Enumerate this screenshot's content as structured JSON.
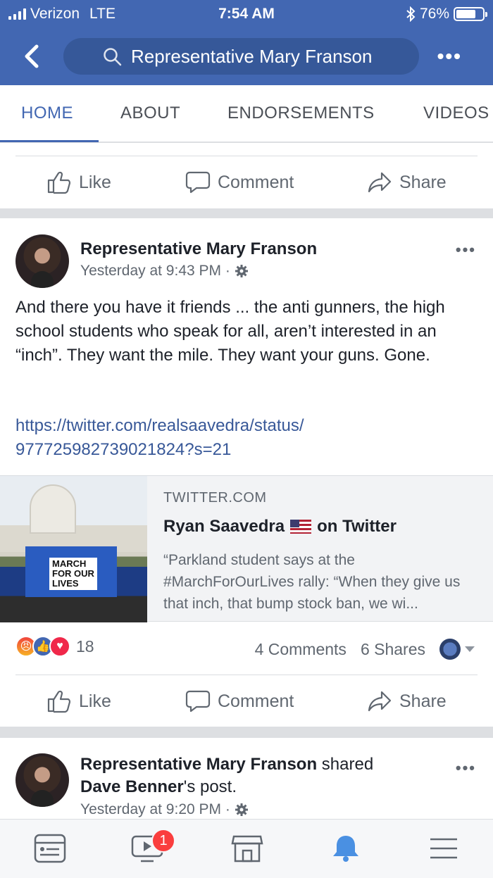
{
  "status": {
    "carrier": "Verizon",
    "network": "LTE",
    "time": "7:54 AM",
    "battery": "76%",
    "battery_level": 0.76
  },
  "header": {
    "search_text": "Representative Mary Franson"
  },
  "tabs": [
    "HOME",
    "ABOUT",
    "ENDORSEMENTS",
    "VIDEOS"
  ],
  "actions": {
    "like": "Like",
    "comment": "Comment",
    "share": "Share"
  },
  "post1": {
    "author": "Representative Mary Franson",
    "time": "Yesterday at 9:43 PM ·",
    "text": "And there you have it friends ... the anti gunners, the high school students who speak for all, aren’t interested in an “inch”. They want the mile. They want your guns. Gone.",
    "link_line1": "https://twitter.com/realsaavedra/status/",
    "link_line2": "977725982739021824?s=21",
    "preview": {
      "domain": "TWITTER.COM",
      "title_a": "Ryan Saavedra",
      "title_b": "on Twitter",
      "description": "“Parkland student says at the #MarchForOurLives rally: “When they give us that inch, that bump stock ban, we wi...",
      "sign_text_line1": "MARCH",
      "sign_text_line2": "FOR OUR",
      "sign_text_line3": "LIVES"
    },
    "reaction_count": "18",
    "comments": "4 Comments",
    "shares": "6 Shares"
  },
  "post2": {
    "author": "Representative Mary Franson",
    "shared_word": "shared",
    "shared_from": "Dave Benner",
    "shared_suffix": "'s post.",
    "time": "Yesterday at 9:20 PM ·"
  },
  "nav": {
    "badge": "1"
  },
  "colors": {
    "brand": "#4267b2",
    "link": "#385898",
    "badge": "#fa3e3e"
  }
}
